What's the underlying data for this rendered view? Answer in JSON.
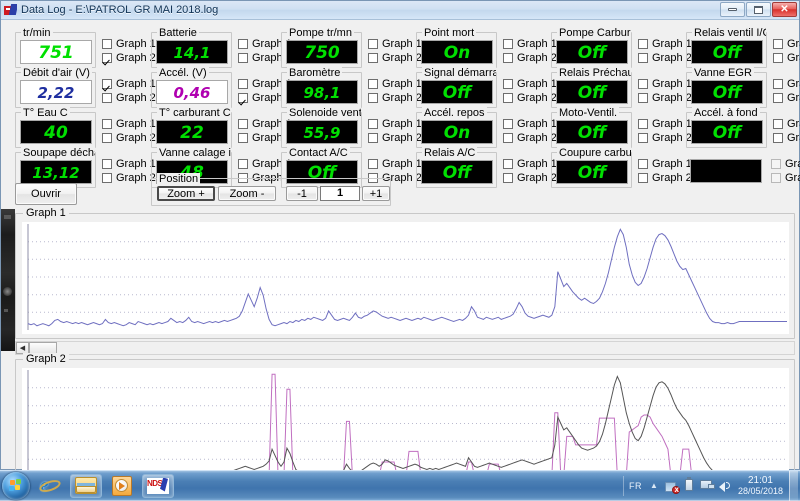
{
  "window": {
    "title": "Data Log - E:\\PATROL GR MAI 2018.log",
    "icon": "app-icon",
    "minimize_label": "_",
    "maximize_label": "□",
    "close_label": "✕"
  },
  "gauges": [
    {
      "label": "tr/min",
      "value": "751",
      "style": "white-blackdigit",
      "g1": false,
      "g2": true
    },
    {
      "label": "Batterie",
      "value": "14,1",
      "style": "lcd-green",
      "g1": false,
      "g2": false
    },
    {
      "label": "Pompe tr/mn",
      "value": "750",
      "style": "lcd-green",
      "g1": false,
      "g2": false
    },
    {
      "label": "Point mort",
      "value": "On",
      "style": "lcd-green",
      "g1": false,
      "g2": false
    },
    {
      "label": "Pompe Carbura",
      "value": "Off",
      "style": "lcd-green",
      "g1": false,
      "g2": false
    },
    {
      "label": "Relais ventil I/C",
      "value": "Off",
      "style": "lcd-green",
      "g1": false,
      "g2": false
    },
    {
      "label": "Débit d'air (V)",
      "value": "2,22",
      "style": "white-blue",
      "g1": true,
      "g2": false
    },
    {
      "label": "Accél. (V)",
      "value": "0,46",
      "style": "white-purple",
      "g1": false,
      "g2": true
    },
    {
      "label": "Baromètre",
      "value": "98,1",
      "style": "lcd-green",
      "g1": false,
      "g2": false
    },
    {
      "label": "Signal démarra",
      "value": "Off",
      "style": "lcd-green",
      "g1": false,
      "g2": false
    },
    {
      "label": "Relais Préchau",
      "value": "Off",
      "style": "lcd-green",
      "g1": false,
      "g2": false
    },
    {
      "label": "Vanne EGR",
      "value": "Off",
      "style": "lcd-green",
      "g1": false,
      "g2": false
    },
    {
      "label": "T° Eau C",
      "value": "40",
      "style": "lcd-green",
      "g1": false,
      "g2": false
    },
    {
      "label": "T° carburant C",
      "value": "22",
      "style": "lcd-green",
      "g1": false,
      "g2": false
    },
    {
      "label": "Solenoide ventil",
      "value": "55,9",
      "style": "lcd-green",
      "g1": false,
      "g2": false
    },
    {
      "label": "Accél. repos",
      "value": "On",
      "style": "lcd-green",
      "g1": false,
      "g2": false
    },
    {
      "label": "Moto-Ventil.",
      "value": "Off",
      "style": "lcd-green",
      "g1": false,
      "g2": false
    },
    {
      "label": "Accél. à fond",
      "value": "Off",
      "style": "lcd-green",
      "g1": false,
      "g2": false
    },
    {
      "label": "Soupape décha",
      "value": "13,12",
      "style": "lcd-green",
      "g1": false,
      "g2": false
    },
    {
      "label": "Vanne calage in",
      "value": "48",
      "style": "lcd-green",
      "g1": false,
      "g2": false
    },
    {
      "label": "Contact A/C",
      "value": "Off",
      "style": "lcd-green",
      "g1": false,
      "g2": false
    },
    {
      "label": "Relais A/C",
      "value": "Off",
      "style": "lcd-green",
      "g1": false,
      "g2": false
    },
    {
      "label": "Coupure carbur",
      "value": "Off",
      "style": "lcd-green",
      "g1": false,
      "g2": false
    },
    {
      "label": "",
      "value": "",
      "style": "lcd-empty",
      "g1": false,
      "g2": false,
      "disabled": true
    }
  ],
  "checkbox_labels": {
    "graph1": "Graph 1",
    "graph2": "Graph 2"
  },
  "buttons": {
    "open": "Ouvrir",
    "zoom_in": "Zoom +",
    "zoom_out": "Zoom -",
    "pos_minus": "-1",
    "pos_plus": "+1"
  },
  "position": {
    "legend": "Position",
    "value": "1"
  },
  "graphs": {
    "graph1_label": "Graph 1",
    "graph2_label": "Graph 2"
  },
  "colors": {
    "lcd_green": "#00e000",
    "lcd_blue": "#1f2fa0",
    "lcd_purple": "#b000b0",
    "graph1_trace": "#6f6fc0",
    "graph2_trace_dark": "#555555",
    "graph2_trace_pink": "#c06fc0",
    "taskbar": "#3f74ad",
    "titlebar": "#cfe0f2"
  },
  "taskbar": {
    "start_label": "start-orb",
    "items": [
      {
        "name": "internet-explorer",
        "label": "Internet Explorer"
      },
      {
        "name": "windows-explorer",
        "label": "Windows Explorer"
      },
      {
        "name": "media-player",
        "label": "Media Player"
      },
      {
        "name": "nds-app",
        "label": "NDS"
      }
    ],
    "tray": {
      "language": "FR",
      "clock_time": "21:01",
      "clock_date": "28/05/2018"
    }
  },
  "chart_data": [
    {
      "type": "line",
      "title": "Graph 1",
      "xlabel": "",
      "ylabel": "",
      "grid": true,
      "gridlines_y": 5,
      "legend": "none",
      "series": [
        {
          "name": "tr/min",
          "color": "#6f6fc0",
          "values": [
            0.06,
            0.05,
            0.06,
            0.04,
            0.05,
            0.06,
            0.05,
            0.04,
            0.06,
            0.09,
            0.1,
            0.08,
            0.07,
            0.08,
            0.07,
            0.06,
            0.07,
            0.06,
            0.07,
            0.06,
            0.05,
            0.06,
            0.07,
            0.06,
            0.05,
            0.06,
            0.1,
            0.07,
            0.06,
            0.07,
            0.06,
            0.05,
            0.04,
            0.05,
            0.07,
            0.06,
            0.05,
            0.08,
            0.07,
            0.06,
            0.05,
            0.06,
            0.05,
            0.06,
            0.07,
            0.06,
            0.07,
            0.08,
            0.11,
            0.09,
            0.07,
            0.08,
            0.07,
            0.09,
            0.12,
            0.08,
            0.07,
            0.08,
            0.07,
            0.06,
            0.07,
            0.08,
            0.07,
            0.08,
            0.07,
            0.08,
            0.09,
            0.08,
            0.09,
            0.1,
            0.11,
            0.13,
            0.18,
            0.26,
            0.34,
            0.28,
            0.22,
            0.3,
            0.4,
            0.33,
            0.2,
            0.1,
            0.05,
            0.04,
            0.05,
            0.06,
            0.07,
            0.06,
            0.08,
            0.07,
            0.09,
            0.08,
            0.1,
            0.09,
            0.11,
            0.1,
            0.12,
            0.11,
            0.1,
            0.09,
            0.11,
            0.18,
            0.14,
            0.1,
            0.09,
            0.1,
            0.11,
            0.1,
            0.09,
            0.12,
            0.16,
            0.12,
            0.11,
            0.13,
            0.14,
            0.16,
            0.18,
            0.17,
            0.15,
            0.13,
            0.12,
            0.11,
            0.12,
            0.11,
            0.1,
            0.09,
            0.1,
            0.11,
            0.1,
            0.09,
            0.1,
            0.11,
            0.1,
            0.12,
            0.11,
            0.1,
            0.09,
            0.1,
            0.11,
            0.12,
            0.11,
            0.1,
            0.09,
            0.08,
            0.09,
            0.1,
            0.09,
            0.11,
            0.14,
            0.22,
            0.18,
            0.12,
            0.11,
            0.1,
            0.12,
            0.11,
            0.1,
            0.11,
            0.12,
            0.1,
            0.11,
            0.12,
            0.13,
            0.15,
            0.2,
            0.26,
            0.22,
            0.16,
            0.13,
            0.12,
            0.11,
            0.12,
            0.13,
            0.14,
            0.13,
            0.12,
            0.14,
            0.22,
            0.55,
            0.48,
            0.41,
            0.44,
            0.4,
            0.36,
            0.33,
            0.3,
            0.28,
            0.3,
            0.28,
            0.26,
            0.25,
            0.27,
            0.3,
            0.36,
            0.44,
            0.54,
            0.66,
            0.78,
            0.88,
            0.95,
            0.9,
            0.78,
            0.62,
            0.52,
            0.45,
            0.42,
            0.44,
            0.5,
            0.58,
            0.68,
            0.78,
            0.86,
            0.9,
            0.91,
            0.89,
            0.85,
            0.79,
            0.72,
            0.65,
            0.6,
            0.57,
            0.58,
            0.52,
            0.46,
            0.4,
            0.34,
            0.28,
            0.22,
            0.16,
            0.11,
            0.08,
            0.07,
            0.07,
            0.06,
            0.06,
            0.07,
            0.06,
            0.06,
            0.07,
            0.08,
            0.08,
            0.08,
            0.08,
            0.08,
            0.08,
            0.08,
            0.08,
            0.08,
            0.08,
            0.08,
            0.08,
            0.08,
            0.08,
            0.08,
            0.08,
            0.08
          ]
        }
      ],
      "ylim": [
        0,
        1
      ]
    },
    {
      "type": "line",
      "title": "Graph 2",
      "xlabel": "",
      "ylabel": "",
      "grid": true,
      "gridlines_y": 5,
      "legend": "none",
      "series": [
        {
          "name": "Accél. (V)",
          "color": "#c06fc0",
          "values": [
            0.01,
            0.01,
            0.01,
            0.01,
            0.01,
            0.01,
            0.01,
            0.01,
            0.01,
            0.01,
            0.01,
            0.01,
            0.01,
            0.01,
            0.01,
            0.01,
            0.01,
            0.01,
            0.01,
            0.01,
            0.01,
            0.01,
            0.01,
            0.01,
            0.01,
            0.01,
            0.01,
            0.01,
            0.01,
            0.01,
            0.01,
            0.01,
            0.01,
            0.01,
            0.01,
            0.01,
            0.01,
            0.01,
            0.01,
            0.01,
            0.01,
            0.01,
            0.01,
            0.01,
            0.01,
            0.01,
            0.01,
            0.01,
            0.01,
            0.01,
            0.01,
            0.01,
            0.01,
            0.01,
            0.01,
            0.01,
            0.01,
            0.01,
            0.01,
            0.01,
            0.01,
            0.01,
            0.01,
            0.01,
            0.01,
            0.01,
            0.01,
            0.01,
            0.01,
            0.01,
            0.01,
            0.01,
            0.01,
            0.01,
            0.01,
            0.01,
            0.01,
            0.01,
            0.01,
            0.01,
            0.01,
            0.01,
            0.96,
            0.96,
            0.01,
            0.01,
            0.01,
            0.82,
            0.82,
            0.01,
            0.01,
            0.01,
            0.01,
            0.01,
            0.01,
            0.01,
            0.01,
            0.01,
            0.01,
            0.01,
            0.01,
            0.01,
            0.01,
            0.01,
            0.01,
            0.01,
            0.01,
            0.52,
            0.52,
            0.01,
            0.01,
            0.01,
            0.01,
            0.01,
            0.01,
            0.01,
            0.01,
            0.01,
            0.01,
            0.14,
            0.14,
            0.14,
            0.14,
            0.14,
            0.01,
            0.01,
            0.01,
            0.01,
            0.24,
            0.24,
            0.24,
            0.24,
            0.01,
            0.01,
            0.01,
            0.01,
            0.01,
            0.01,
            0.01,
            0.01,
            0.01,
            0.01,
            0.01,
            0.01,
            0.01,
            0.01,
            0.01,
            0.01,
            0.14,
            0.14,
            0.01,
            0.01,
            0.01,
            0.01,
            0.01,
            0.12,
            0.12,
            0.12,
            0.12,
            0.01,
            0.01,
            0.01,
            0.01,
            0.01,
            0.01,
            0.01,
            0.01,
            0.01,
            0.01,
            0.01,
            0.01,
            0.01,
            0.01,
            0.01,
            0.01,
            0.01,
            0.01,
            0.6,
            0.6,
            0.01,
            0.01,
            0.38,
            0.38,
            0.38,
            0.3,
            0.3,
            0.3,
            0.3,
            0.3,
            0.3,
            0.3,
            0.3,
            0.55,
            0.55,
            0.55,
            0.55,
            0.55,
            0.55,
            0.01,
            0.01,
            0.01,
            0.01,
            0.42,
            0.44,
            0.46,
            0.48,
            0.56,
            0.58,
            0.58,
            0.56,
            0.5,
            0.46,
            0.42,
            0.38,
            0.32,
            0.26,
            0.01,
            0.01,
            0.01,
            0.01,
            0.26,
            0.26,
            0.26,
            0.01,
            0.01,
            0.01,
            0.01,
            0.01,
            0.01,
            0.01,
            0.01,
            0.01,
            0.01,
            0.01,
            0.01,
            0.01,
            0.01,
            0.01,
            0.01,
            0.01,
            0.01,
            0.01,
            0.01,
            0.01,
            0.01,
            0.01,
            0.01,
            0.01,
            0.01,
            0.01,
            0.01,
            0.01,
            0.01,
            0.01,
            0.01,
            0.01
          ]
        },
        {
          "name": "tr/min",
          "color": "#555555",
          "values": [
            0.03,
            0.03,
            0.03,
            0.03,
            0.04,
            0.03,
            0.03,
            0.04,
            0.05,
            0.04,
            0.03,
            0.04,
            0.03,
            0.04,
            0.03,
            0.04,
            0.03,
            0.04,
            0.03,
            0.04,
            0.03,
            0.04,
            0.03,
            0.04,
            0.05,
            0.04,
            0.03,
            0.04,
            0.03,
            0.04,
            0.03,
            0.04,
            0.03,
            0.04,
            0.03,
            0.04,
            0.03,
            0.04,
            0.03,
            0.04,
            0.03,
            0.04,
            0.03,
            0.04,
            0.03,
            0.04,
            0.05,
            0.04,
            0.03,
            0.04,
            0.03,
            0.04,
            0.03,
            0.04,
            0.03,
            0.04,
            0.03,
            0.04,
            0.03,
            0.04,
            0.03,
            0.04,
            0.03,
            0.04,
            0.03,
            0.04,
            0.03,
            0.04,
            0.05,
            0.06,
            0.07,
            0.08,
            0.09,
            0.1,
            0.09,
            0.08,
            0.07,
            0.08,
            0.09,
            0.1,
            0.12,
            0.15,
            0.26,
            0.2,
            0.14,
            0.1,
            0.14,
            0.27,
            0.22,
            0.14,
            0.07,
            0.05,
            0.04,
            0.05,
            0.04,
            0.05,
            0.04,
            0.05,
            0.04,
            0.05,
            0.04,
            0.05,
            0.04,
            0.05,
            0.04,
            0.05,
            0.06,
            0.12,
            0.08,
            0.05,
            0.04,
            0.05,
            0.06,
            0.08,
            0.1,
            0.12,
            0.13,
            0.12,
            0.1,
            0.12,
            0.16,
            0.15,
            0.13,
            0.11,
            0.1,
            0.09,
            0.08,
            0.09,
            0.1,
            0.11,
            0.12,
            0.11,
            0.09,
            0.08,
            0.07,
            0.08,
            0.07,
            0.08,
            0.07,
            0.08,
            0.09,
            0.1,
            0.11,
            0.12,
            0.13,
            0.12,
            0.11,
            0.1,
            0.18,
            0.14,
            0.1,
            0.09,
            0.1,
            0.11,
            0.12,
            0.13,
            0.12,
            0.11,
            0.1,
            0.09,
            0.1,
            0.11,
            0.12,
            0.13,
            0.14,
            0.15,
            0.16,
            0.15,
            0.14,
            0.13,
            0.12,
            0.13,
            0.14,
            0.15,
            0.16,
            0.17,
            0.18,
            0.3,
            0.56,
            0.5,
            0.44,
            0.46,
            0.42,
            0.38,
            0.34,
            0.3,
            0.27,
            0.26,
            0.25,
            0.26,
            0.27,
            0.29,
            0.33,
            0.4,
            0.5,
            0.62,
            0.74,
            0.86,
            0.94,
            0.88,
            0.74,
            0.6,
            0.5,
            0.42,
            0.36,
            0.34,
            0.38,
            0.46,
            0.56,
            0.66,
            0.76,
            0.84,
            0.88,
            0.89,
            0.87,
            0.83,
            0.77,
            0.7,
            0.64,
            0.6,
            0.56,
            0.53,
            0.48,
            0.42,
            0.36,
            0.3,
            0.24,
            0.18,
            0.13,
            0.09,
            0.06,
            0.05,
            0.05,
            0.05,
            0.05,
            0.05,
            0.05,
            0.05,
            0.06,
            0.06,
            0.06,
            0.06,
            0.06,
            0.06,
            0.06,
            0.06,
            0.06,
            0.06,
            0.06,
            0.06,
            0.06,
            0.06,
            0.06,
            0.06,
            0.06,
            0.06
          ]
        }
      ],
      "ylim": [
        0,
        1
      ]
    }
  ]
}
